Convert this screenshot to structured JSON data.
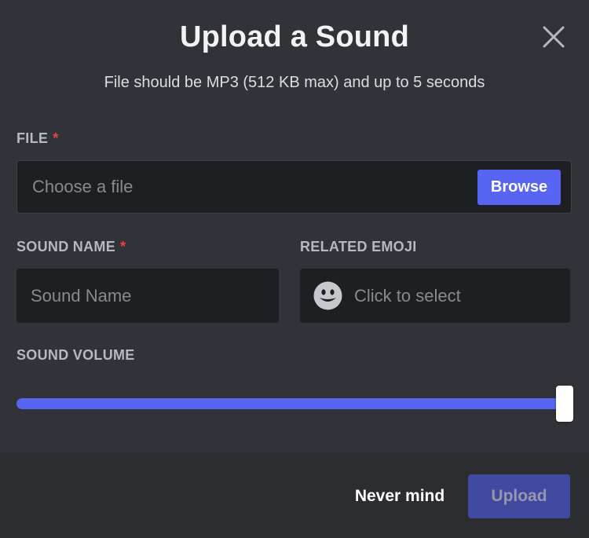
{
  "dialog": {
    "title": "Upload a Sound",
    "subtitle": "File should be MP3 (512 KB max) and up to 5 seconds"
  },
  "file": {
    "label": "FILE",
    "required_marker": "*",
    "placeholder": "Choose a file",
    "browse_label": "Browse"
  },
  "sound_name": {
    "label": "SOUND NAME",
    "required_marker": "*",
    "placeholder": "Sound Name",
    "value": ""
  },
  "related_emoji": {
    "label": "RELATED EMOJI",
    "placeholder": "Click to select",
    "icon": "smiley-face-icon"
  },
  "sound_volume": {
    "label": "SOUND VOLUME",
    "value_fraction": 1.0
  },
  "footer": {
    "cancel_label": "Never mind",
    "upload_label": "Upload"
  },
  "colors": {
    "accent": "#5865f2",
    "background": "#313338",
    "footer_background": "#2b2d31",
    "input_background": "#1e1f22",
    "required": "#f23f43"
  },
  "icons": {
    "close": "close-icon"
  }
}
